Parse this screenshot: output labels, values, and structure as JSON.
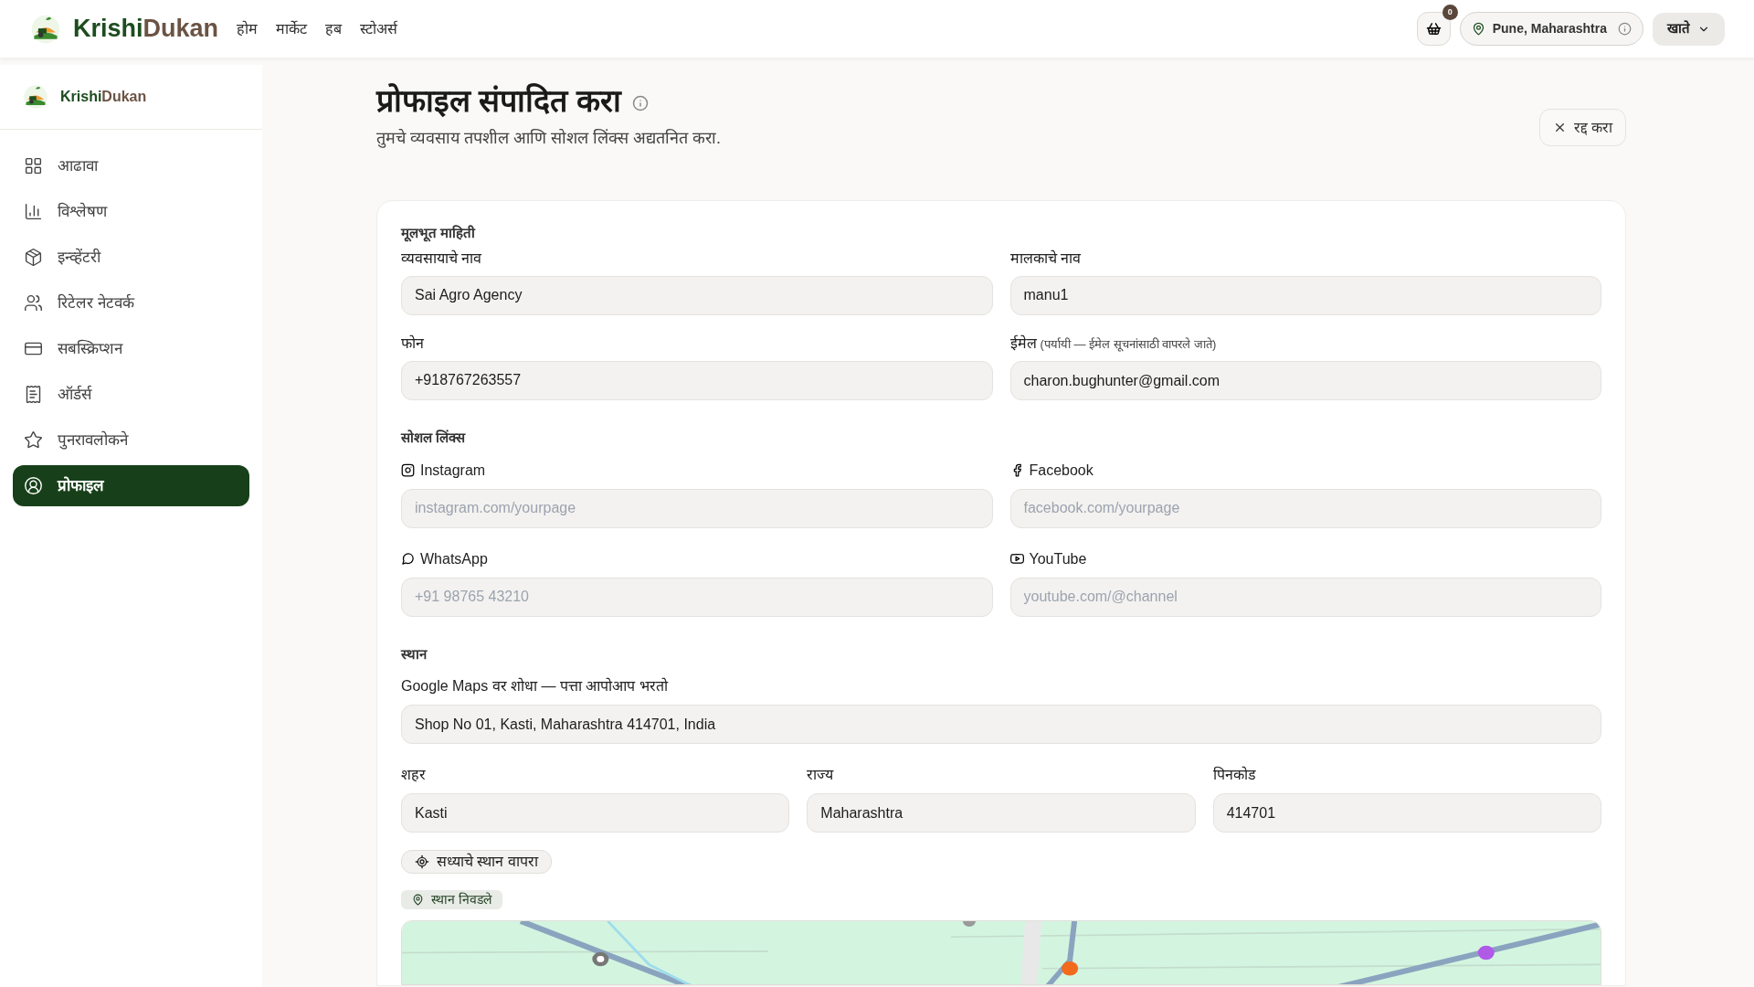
{
  "topbar": {
    "brand_first": "Krishi",
    "brand_second": "Dukan",
    "nav": [
      "होम",
      "मार्केट",
      "हब",
      "स्टोअर्स"
    ],
    "cart_count": "0",
    "location": "Pune, Maharashtra",
    "account": "खाते"
  },
  "sidebar": {
    "brand_first": "Krishi",
    "brand_second": "Dukan",
    "items": [
      {
        "label": "आढावा",
        "selected": false
      },
      {
        "label": "विश्लेषण",
        "selected": false
      },
      {
        "label": "इन्व्हेंटरी",
        "selected": false
      },
      {
        "label": "रिटेलर नेटवर्क",
        "selected": false
      },
      {
        "label": "सबस्क्रिप्शन",
        "selected": false
      },
      {
        "label": "ऑर्डर्स",
        "selected": false
      },
      {
        "label": "पुनरावलोकने",
        "selected": false
      },
      {
        "label": "प्रोफाइल",
        "selected": true
      }
    ]
  },
  "page": {
    "title": "प्रोफाइल संपादित करा",
    "subtitle": "तुमचे व्यवसाय तपशील आणि सोशल लिंक्स अद्यतनित करा.",
    "cancel": "रद्द करा"
  },
  "basic": {
    "heading": "मूलभूत माहिती",
    "fields": [
      {
        "label": "व्यवसायाचे नाव",
        "value": "Sai Agro Agency"
      },
      {
        "label": "मालकाचे नाव",
        "value": "manu1"
      },
      {
        "label": "फोन",
        "value": "+918767263557"
      },
      {
        "label": "ईमेल",
        "hint": "(पर्यायी — ईमेल सूचनांसाठी वापरले जाते)",
        "value": "charon.bughunter@gmail.com"
      }
    ]
  },
  "social": {
    "heading": "सोशल लिंक्स",
    "fields": [
      {
        "label": "Instagram",
        "placeholder": "instagram.com/yourpage"
      },
      {
        "label": "Facebook",
        "placeholder": "facebook.com/yourpage"
      },
      {
        "label": "WhatsApp",
        "placeholder": "+91 98765 43210"
      },
      {
        "label": "YouTube",
        "placeholder": "youtube.com/@channel"
      }
    ]
  },
  "location": {
    "heading": "स्थान",
    "search": {
      "label": "Google Maps वर शोधा — पत्ता आपोआप भरतो",
      "value": "Shop No 01, Kasti, Maharashtra 414701, India"
    },
    "fields": [
      {
        "label": "शहर",
        "value": "Kasti"
      },
      {
        "label": "राज्य",
        "value": "Maharashtra"
      },
      {
        "label": "पिनकोड",
        "value": "414701"
      }
    ],
    "locate_button": "सध्याचे स्थान वापरा",
    "badge": "स्थान निवडले"
  }
}
